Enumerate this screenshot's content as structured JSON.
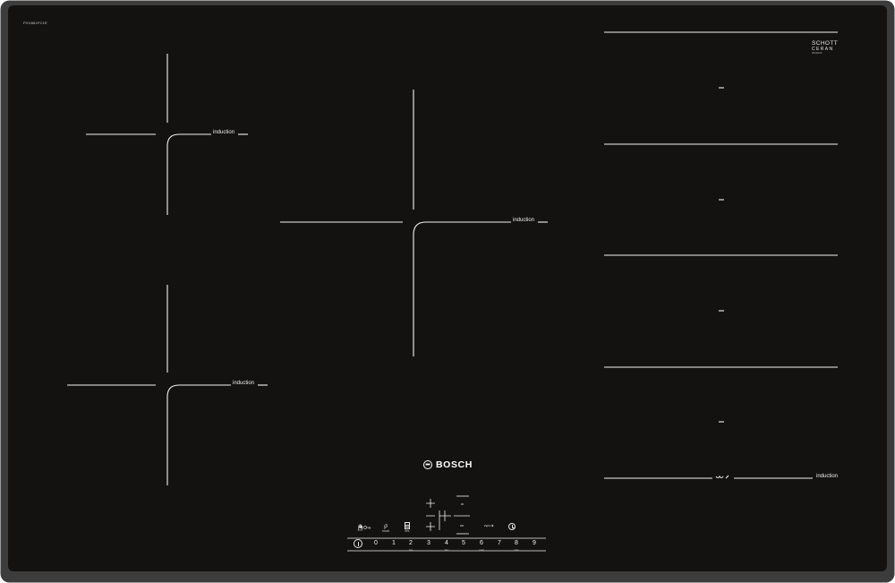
{
  "product": {
    "model_code": "PXV851FC1E",
    "glass_brand": {
      "line1": "SCHOTT",
      "line2": "CERAN",
      "line3": "0000000"
    },
    "brand": "BOSCH"
  },
  "colors": {
    "frame": "#3c3c3c",
    "glass": "#141211",
    "marking": "#f4f4f4"
  },
  "zones": {
    "front_left_label": "induction",
    "rear_left_label": "induction",
    "center_label": "induction",
    "flex_zone_label": "induction"
  },
  "controls": {
    "childlock_icon": "hand-key-icon",
    "boost_icon": "boost-icon",
    "boost_label": "boost",
    "flex_icon": "flex-zone-icon",
    "flex_label": "flex",
    "move_icon": "move-icon",
    "timer_icon": "timer-icon",
    "power_icon": "power-icon",
    "power_levels": [
      "0",
      "1",
      "2",
      "3",
      "4",
      "5",
      "6",
      "7",
      "8",
      "9"
    ],
    "power_sublabels": [
      "",
      "",
      "sim",
      "",
      "dec",
      "",
      "med",
      "",
      "max",
      ""
    ]
  }
}
